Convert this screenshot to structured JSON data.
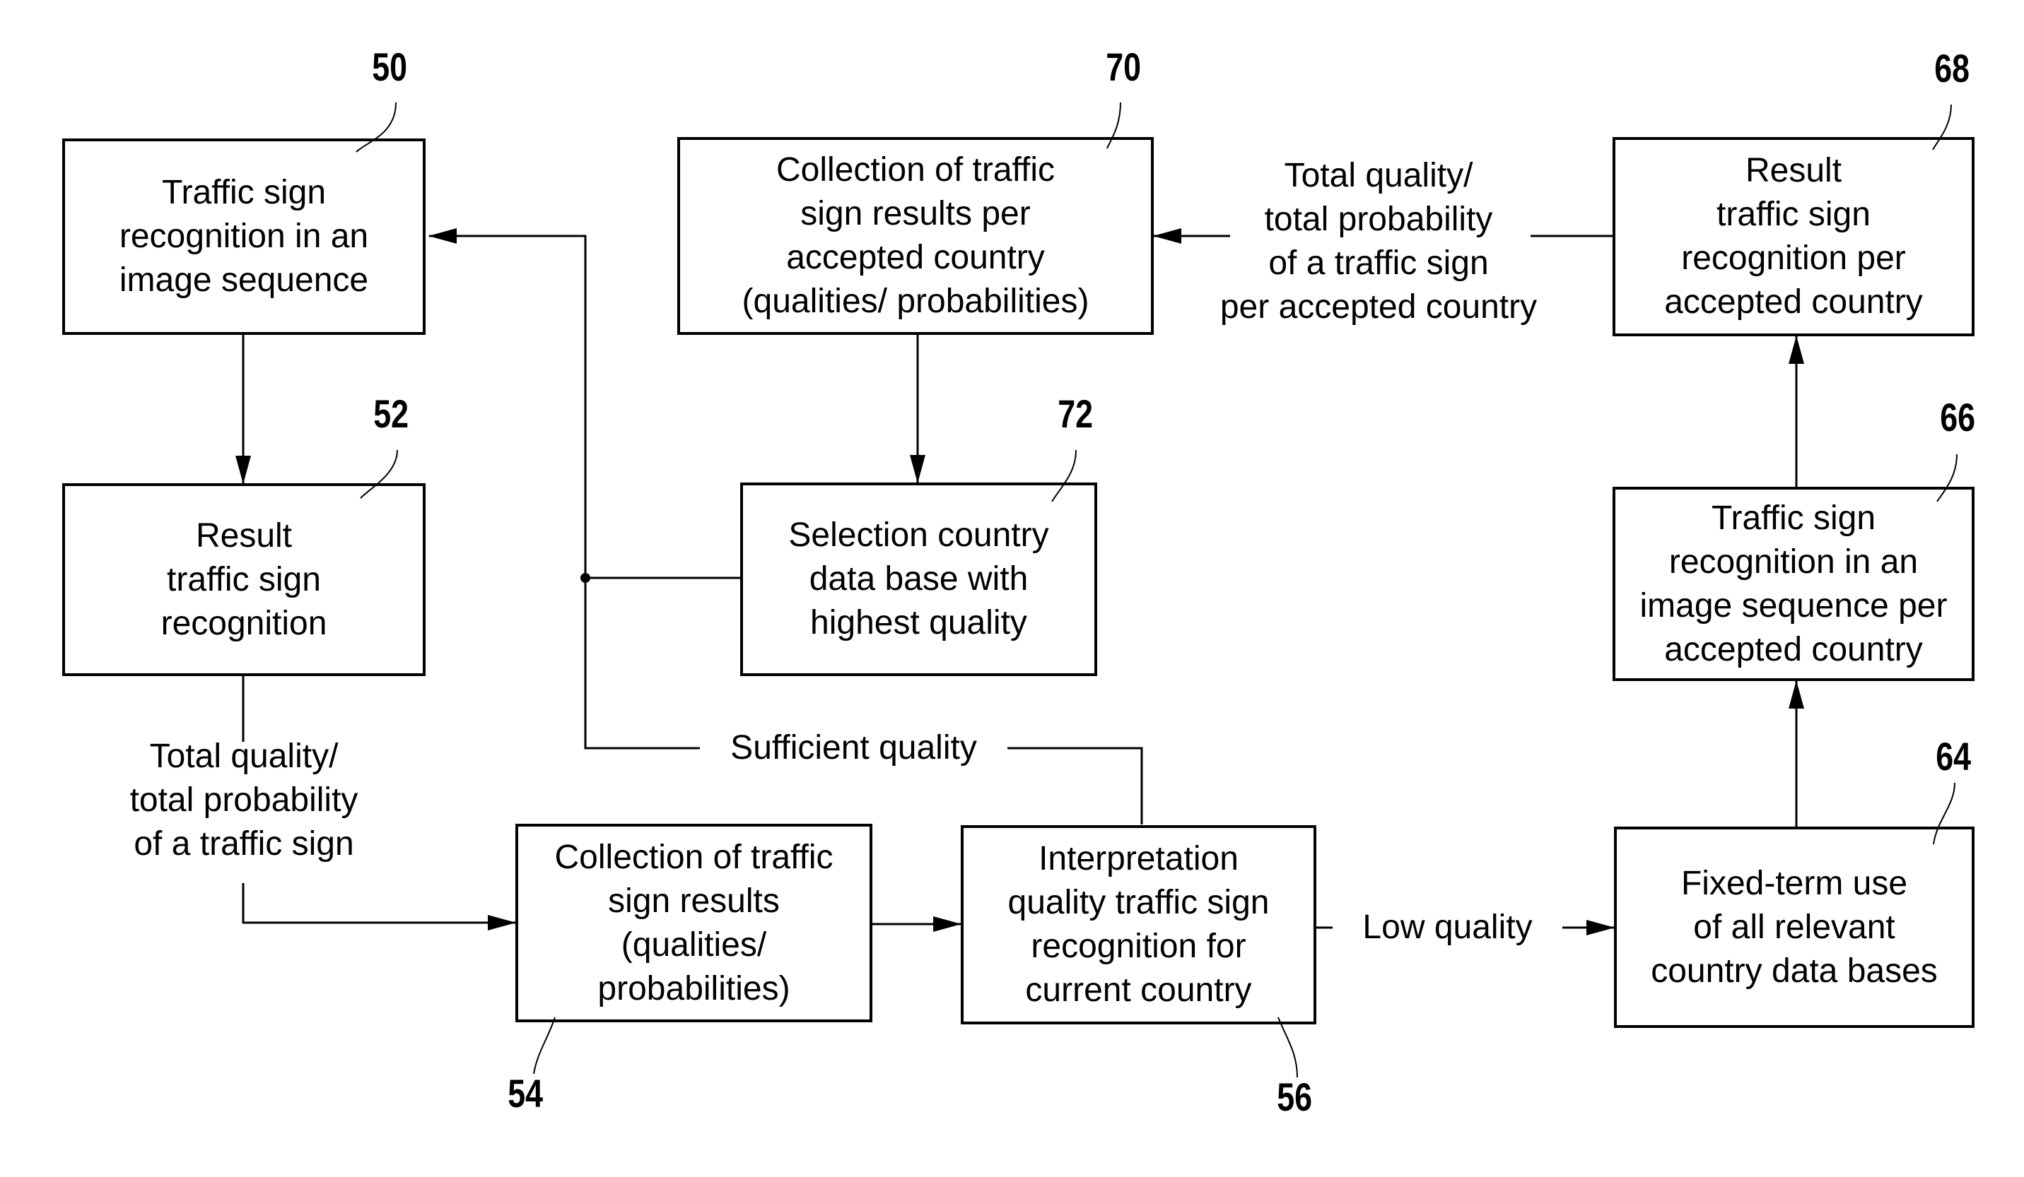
{
  "boxes": {
    "b50": {
      "ref": "50",
      "text": "Traffic sign\nrecognition in an\nimage sequence"
    },
    "b52": {
      "ref": "52",
      "text": "Result\ntraffic sign\nrecognition"
    },
    "b70": {
      "ref": "70",
      "text": "Collection of traffic\nsign results per\naccepted country\n(qualities/ probabilities)"
    },
    "b72": {
      "ref": "72",
      "text": "Selection country\ndata base with\nhighest quality"
    },
    "b68": {
      "ref": "68",
      "text": "Result\ntraffic sign\nrecognition per\naccepted country"
    },
    "b66": {
      "ref": "66",
      "text": "Traffic sign\nrecognition in an\nimage sequence per\naccepted country"
    },
    "b64": {
      "ref": "64",
      "text": "Fixed-term use\nof all relevant\ncountry data bases"
    },
    "b54": {
      "ref": "54",
      "text": "Collection of traffic\nsign results\n(qualities/\nprobabilities)"
    },
    "b56": {
      "ref": "56",
      "text": "Interpretation\nquality traffic sign\nrecognition for\ncurrent country"
    }
  },
  "labels": {
    "total_quality": "Total quality/\ntotal probability\nof a traffic sign",
    "total_quality_country": "Total quality/\ntotal probability\nof a traffic sign\nper accepted country",
    "sufficient": "Sufficient quality",
    "low": "Low quality"
  }
}
